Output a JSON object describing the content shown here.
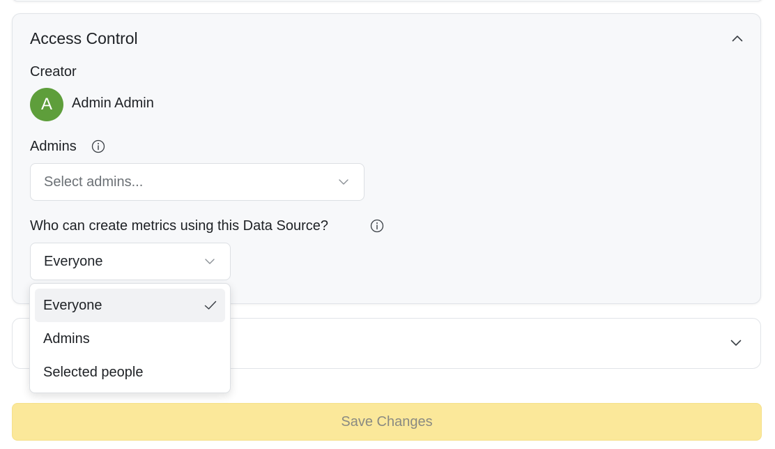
{
  "access_control": {
    "title": "Access Control",
    "creator_label": "Creator",
    "creator": {
      "initial": "A",
      "name": "Admin Admin",
      "avatar_color": "#5e9e3b"
    },
    "admins_label": "Admins",
    "admins_select": {
      "placeholder": "Select admins..."
    },
    "metrics_label": "Who can create metrics using this Data Source?",
    "metrics_select": {
      "value": "Everyone",
      "options": [
        {
          "label": "Everyone",
          "selected": true
        },
        {
          "label": "Admins",
          "selected": false
        },
        {
          "label": "Selected people",
          "selected": false
        }
      ]
    }
  },
  "footer": {
    "save_label": "Save Changes"
  },
  "colors": {
    "accent_yellow": "#fbe89a",
    "card_bg": "#f7f8fa"
  },
  "icons": {
    "collapse": "chevron-up-icon",
    "expand": "chevron-down-icon",
    "info": "info-icon",
    "check": "check-icon"
  }
}
